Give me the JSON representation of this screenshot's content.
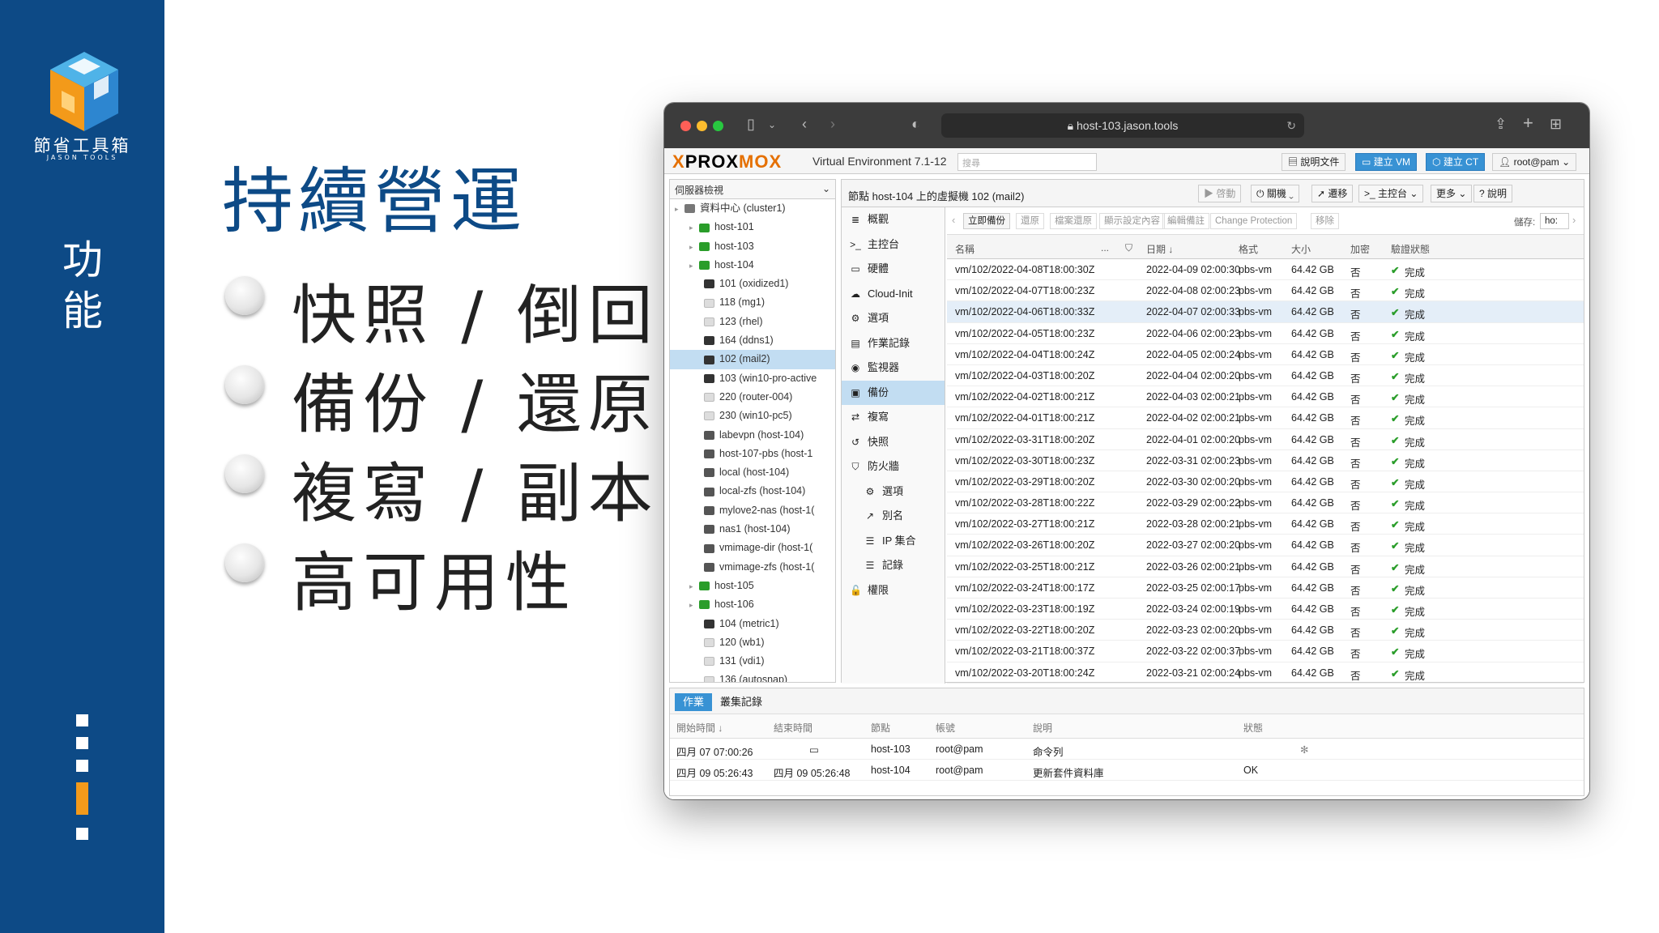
{
  "sidebar": {
    "logo_text": "節省工具箱",
    "logo_sub": "JASON TOOLS",
    "section_label": "功能"
  },
  "slide": {
    "title": "持續營運",
    "bullets": [
      "快照 / 倒回",
      "備份 / 還原",
      "複寫 / 副本",
      "高可用性"
    ]
  },
  "browser": {
    "url": "host-103.jason.tools"
  },
  "pve": {
    "logo_x": "X",
    "logo_prox": "PROX",
    "logo_mo": "MO",
    "logo_x2": "X",
    "version": "Virtual Environment 7.1-12",
    "search_placeholder": "搜尋",
    "docs_btn": "說明文件",
    "create_vm_btn": "建立 VM",
    "create_ct_btn": "建立 CT",
    "user_btn": "root@pam",
    "server_view": "伺服器檢視"
  },
  "tree": [
    {
      "label": "資料中心 (cluster1)",
      "indent": 0,
      "type": "dc"
    },
    {
      "label": "host-101",
      "indent": 1,
      "type": "node"
    },
    {
      "label": "host-103",
      "indent": 1,
      "type": "node"
    },
    {
      "label": "host-104",
      "indent": 1,
      "type": "node"
    },
    {
      "label": "101 (oxidized1)",
      "indent": 2,
      "type": "ct"
    },
    {
      "label": "118 (mg1)",
      "indent": 2,
      "type": "off"
    },
    {
      "label": "123 (rhel)",
      "indent": 2,
      "type": "off"
    },
    {
      "label": "164 (ddns1)",
      "indent": 2,
      "type": "ct"
    },
    {
      "label": "102 (mail2)",
      "indent": 2,
      "type": "vm",
      "selected": true
    },
    {
      "label": "103 (win10-pro-active",
      "indent": 2,
      "type": "vm"
    },
    {
      "label": "220 (router-004)",
      "indent": 2,
      "type": "off"
    },
    {
      "label": "230 (win10-pc5)",
      "indent": 2,
      "type": "off"
    },
    {
      "label": "labevpn (host-104)",
      "indent": 2,
      "type": "grid"
    },
    {
      "label": "host-107-pbs (host-1",
      "indent": 2,
      "type": "storage"
    },
    {
      "label": "local (host-104)",
      "indent": 2,
      "type": "storage"
    },
    {
      "label": "local-zfs (host-104)",
      "indent": 2,
      "type": "storage"
    },
    {
      "label": "mylove2-nas (host-1(",
      "indent": 2,
      "type": "storage"
    },
    {
      "label": "nas1 (host-104)",
      "indent": 2,
      "type": "storage"
    },
    {
      "label": "vmimage-dir (host-1(",
      "indent": 2,
      "type": "storage"
    },
    {
      "label": "vmimage-zfs (host-1(",
      "indent": 2,
      "type": "storage"
    },
    {
      "label": "host-105",
      "indent": 1,
      "type": "node"
    },
    {
      "label": "host-106",
      "indent": 1,
      "type": "node"
    },
    {
      "label": "104 (metric1)",
      "indent": 2,
      "type": "ct"
    },
    {
      "label": "120 (wb1)",
      "indent": 2,
      "type": "off"
    },
    {
      "label": "131 (vdi1)",
      "indent": 2,
      "type": "off"
    },
    {
      "label": "136 (autosnap)",
      "indent": 2,
      "type": "off"
    }
  ],
  "content": {
    "title": "節點 host-104 上的虛擬機 102 (mail2)",
    "start_btn": "啓動",
    "shutdown_btn": "關機",
    "migrate_btn": "遷移",
    "console_btn": "主控台",
    "more_btn": "更多",
    "help_btn": "說明"
  },
  "menu": [
    {
      "label": "概觀",
      "icon": "≣"
    },
    {
      "label": "主控台",
      "icon": ">_"
    },
    {
      "label": "硬體",
      "icon": "▭"
    },
    {
      "label": "Cloud-Init",
      "icon": "☁"
    },
    {
      "label": "選項",
      "icon": "⚙"
    },
    {
      "label": "作業記錄",
      "icon": "▤"
    },
    {
      "label": "監視器",
      "icon": "◉"
    },
    {
      "label": "備份",
      "icon": "▣",
      "selected": true
    },
    {
      "label": "複寫",
      "icon": "⇄"
    },
    {
      "label": "快照",
      "icon": "↺"
    },
    {
      "label": "防火牆",
      "icon": "⛉"
    },
    {
      "label": "選項",
      "icon": "⚙",
      "sub": true
    },
    {
      "label": "別名",
      "icon": "↗",
      "sub": true
    },
    {
      "label": "IP 集合",
      "icon": "☰",
      "sub": true
    },
    {
      "label": "記錄",
      "icon": "☰",
      "sub": true
    },
    {
      "label": "權限",
      "icon": "🔓"
    }
  ],
  "backup_toolbar": {
    "backup_now": "立即備份",
    "restore": "還原",
    "file_restore": "檔案還原",
    "show_config": "顯示設定內容",
    "edit_notes": "編輯備註",
    "change_protection": "Change Protection",
    "remove": "移除",
    "storage_label": "儲存:",
    "storage_value": "ho:"
  },
  "grid_headers": {
    "name": "名稱",
    "dots": "...",
    "date": "日期 ↓",
    "format": "格式",
    "size": "大小",
    "encrypted": "加密",
    "verify": "驗證狀態"
  },
  "backups": [
    {
      "name": "vm/102/2022-04-08T18:00:30Z",
      "date": "2022-04-09 02:00:30",
      "format": "pbs-vm",
      "size": "64.42 GB",
      "enc": "否",
      "verify": "完成"
    },
    {
      "name": "vm/102/2022-04-07T18:00:23Z",
      "date": "2022-04-08 02:00:23",
      "format": "pbs-vm",
      "size": "64.42 GB",
      "enc": "否",
      "verify": "完成"
    },
    {
      "name": "vm/102/2022-04-06T18:00:33Z",
      "date": "2022-04-07 02:00:33",
      "format": "pbs-vm",
      "size": "64.42 GB",
      "enc": "否",
      "verify": "完成",
      "selected": true
    },
    {
      "name": "vm/102/2022-04-05T18:00:23Z",
      "date": "2022-04-06 02:00:23",
      "format": "pbs-vm",
      "size": "64.42 GB",
      "enc": "否",
      "verify": "完成"
    },
    {
      "name": "vm/102/2022-04-04T18:00:24Z",
      "date": "2022-04-05 02:00:24",
      "format": "pbs-vm",
      "size": "64.42 GB",
      "enc": "否",
      "verify": "完成"
    },
    {
      "name": "vm/102/2022-04-03T18:00:20Z",
      "date": "2022-04-04 02:00:20",
      "format": "pbs-vm",
      "size": "64.42 GB",
      "enc": "否",
      "verify": "完成"
    },
    {
      "name": "vm/102/2022-04-02T18:00:21Z",
      "date": "2022-04-03 02:00:21",
      "format": "pbs-vm",
      "size": "64.42 GB",
      "enc": "否",
      "verify": "完成"
    },
    {
      "name": "vm/102/2022-04-01T18:00:21Z",
      "date": "2022-04-02 02:00:21",
      "format": "pbs-vm",
      "size": "64.42 GB",
      "enc": "否",
      "verify": "完成"
    },
    {
      "name": "vm/102/2022-03-31T18:00:20Z",
      "date": "2022-04-01 02:00:20",
      "format": "pbs-vm",
      "size": "64.42 GB",
      "enc": "否",
      "verify": "完成"
    },
    {
      "name": "vm/102/2022-03-30T18:00:23Z",
      "date": "2022-03-31 02:00:23",
      "format": "pbs-vm",
      "size": "64.42 GB",
      "enc": "否",
      "verify": "完成"
    },
    {
      "name": "vm/102/2022-03-29T18:00:20Z",
      "date": "2022-03-30 02:00:20",
      "format": "pbs-vm",
      "size": "64.42 GB",
      "enc": "否",
      "verify": "完成"
    },
    {
      "name": "vm/102/2022-03-28T18:00:22Z",
      "date": "2022-03-29 02:00:22",
      "format": "pbs-vm",
      "size": "64.42 GB",
      "enc": "否",
      "verify": "完成"
    },
    {
      "name": "vm/102/2022-03-27T18:00:21Z",
      "date": "2022-03-28 02:00:21",
      "format": "pbs-vm",
      "size": "64.42 GB",
      "enc": "否",
      "verify": "完成"
    },
    {
      "name": "vm/102/2022-03-26T18:00:20Z",
      "date": "2022-03-27 02:00:20",
      "format": "pbs-vm",
      "size": "64.42 GB",
      "enc": "否",
      "verify": "完成"
    },
    {
      "name": "vm/102/2022-03-25T18:00:21Z",
      "date": "2022-03-26 02:00:21",
      "format": "pbs-vm",
      "size": "64.42 GB",
      "enc": "否",
      "verify": "完成"
    },
    {
      "name": "vm/102/2022-03-24T18:00:17Z",
      "date": "2022-03-25 02:00:17",
      "format": "pbs-vm",
      "size": "64.42 GB",
      "enc": "否",
      "verify": "完成"
    },
    {
      "name": "vm/102/2022-03-23T18:00:19Z",
      "date": "2022-03-24 02:00:19",
      "format": "pbs-vm",
      "size": "64.42 GB",
      "enc": "否",
      "verify": "完成"
    },
    {
      "name": "vm/102/2022-03-22T18:00:20Z",
      "date": "2022-03-23 02:00:20",
      "format": "pbs-vm",
      "size": "64.42 GB",
      "enc": "否",
      "verify": "完成"
    },
    {
      "name": "vm/102/2022-03-21T18:00:37Z",
      "date": "2022-03-22 02:00:37",
      "format": "pbs-vm",
      "size": "64.42 GB",
      "enc": "否",
      "verify": "完成"
    },
    {
      "name": "vm/102/2022-03-20T18:00:24Z",
      "date": "2022-03-21 02:00:24",
      "format": "pbs-vm",
      "size": "64.42 GB",
      "enc": "否",
      "verify": "完成"
    }
  ],
  "tasks": {
    "tab_tasks": "作業",
    "tab_cluster_log": "叢集記錄",
    "headers": {
      "start": "開始時間 ↓",
      "end": "結束時間",
      "node": "節點",
      "user": "帳號",
      "desc": "說明",
      "status": "狀態"
    },
    "rows": [
      {
        "start": "四月 07 07:00:26",
        "end": "",
        "node": "host-103",
        "user": "root@pam",
        "desc": "命令列",
        "status": ""
      },
      {
        "start": "四月 09 05:26:43",
        "end": "四月 09 05:26:48",
        "node": "host-104",
        "user": "root@pam",
        "desc": "更新套件資料庫",
        "status": "OK"
      }
    ]
  },
  "colors": {
    "brand_blue": "#0d4a86",
    "accent_orange": "#f39a1a",
    "pve_orange": "#e57000",
    "selection": "#c2ddf2",
    "ok_green": "#2a9d2a"
  }
}
